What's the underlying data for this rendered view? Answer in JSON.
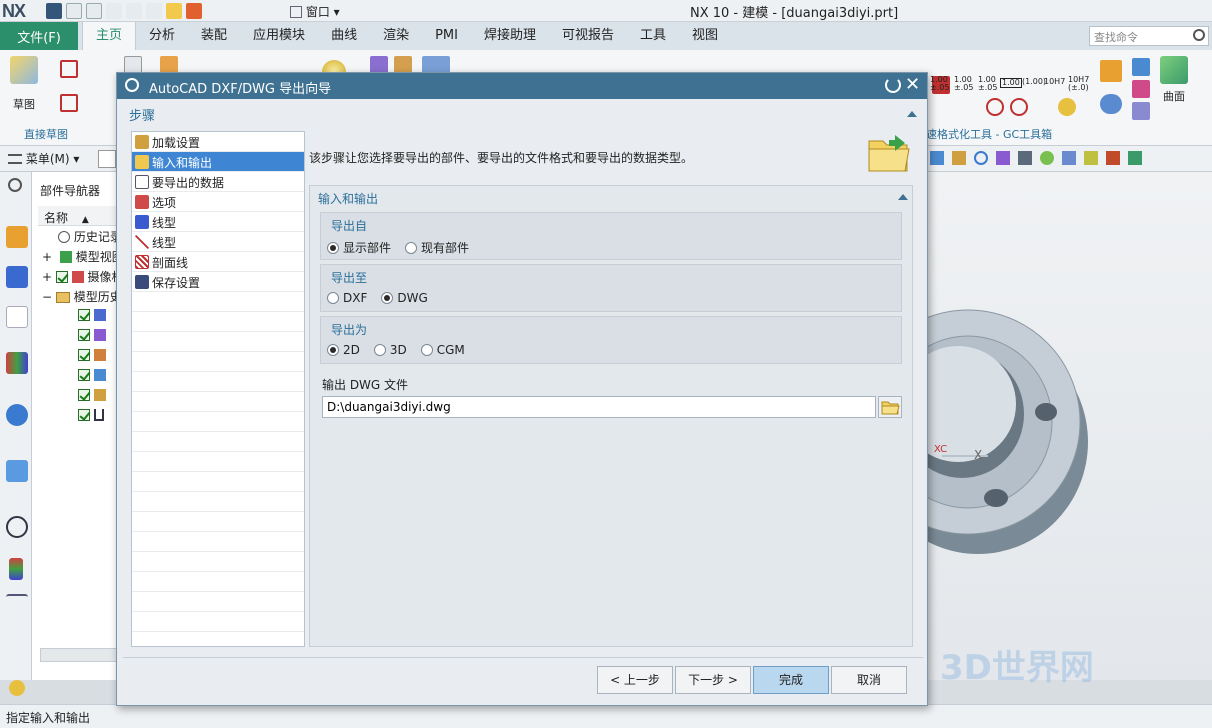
{
  "window": {
    "logo": "NX",
    "title": "NX 10 - 建模 - [duangai3diyi.prt]",
    "window_menu": "窗口"
  },
  "ribbon": {
    "file_tab": "文件(F)",
    "tabs": [
      "主页",
      "分析",
      "装配",
      "应用模块",
      "曲线",
      "渲染",
      "PMI",
      "焊接助理",
      "可视报告",
      "工具",
      "视图"
    ],
    "active_tab": "主页",
    "search_placeholder": "查找命令",
    "sketch_label": "草图",
    "direct_sketch_label": "直接草图",
    "surface_label": "曲面",
    "gc_toolbox_label": "速格式化工具 - GC工具箱",
    "tolerance_labels": [
      "1.00\n±.05",
      "1.00\n±.05",
      "1.00\n±.05",
      "1.00",
      "(1.00)",
      "10H7",
      "10H7\n(±.0)"
    ]
  },
  "toolbar2": {
    "menu_label": "菜单(M)"
  },
  "navigator": {
    "title": "部件导航器",
    "column": "名称",
    "rows": [
      "历史记录",
      "模型视图",
      "摄像机",
      "模型历史"
    ]
  },
  "dialog": {
    "title": "AutoCAD DXF/DWG 导出向导",
    "steps_header": "步骤",
    "steps": [
      {
        "label": "加载设置",
        "selected": false
      },
      {
        "label": "输入和输出",
        "selected": true
      },
      {
        "label": "要导出的数据",
        "selected": false
      },
      {
        "label": "选项",
        "selected": false
      },
      {
        "label": "线型",
        "selected": false
      },
      {
        "label": "线型",
        "selected": false
      },
      {
        "label": "剖面线",
        "selected": false
      },
      {
        "label": "保存设置",
        "selected": false
      }
    ],
    "description": "该步骤让您选择要导出的部件、要导出的文件格式和要导出的数据类型。",
    "section_title": "输入和输出",
    "export_from": {
      "title": "导出自",
      "options": [
        "显示部件",
        "现有部件"
      ],
      "selected": 0
    },
    "export_to": {
      "title": "导出至",
      "options": [
        "DXF",
        "DWG"
      ],
      "selected": 1
    },
    "export_as": {
      "title": "导出为",
      "options": [
        "2D",
        "3D",
        "CGM"
      ],
      "selected": 0
    },
    "output_label": "输出 DWG 文件",
    "output_value": "D:\\duangai3diyi.dwg",
    "buttons": {
      "back": "< 上一步",
      "next": "下一步 >",
      "finish": "完成",
      "cancel": "取消"
    }
  },
  "status": {
    "text": "指定输入和输出"
  },
  "viewport": {
    "axis_label": "X",
    "watermark": "3D世界网"
  },
  "colors": {
    "accent": "#2c8f6b",
    "dialog_title": "#3f7292",
    "selection": "#3e86d4"
  }
}
